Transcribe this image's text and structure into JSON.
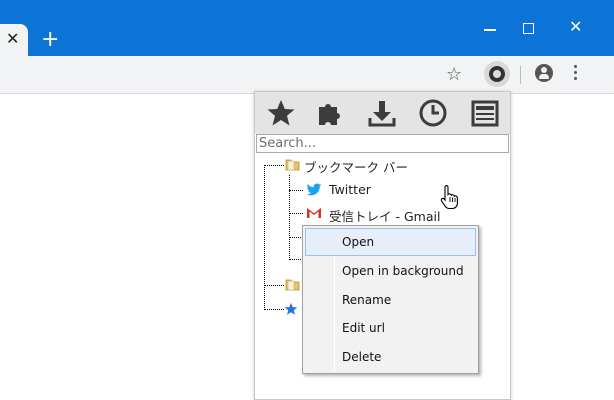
{
  "browser": {
    "tab_close_glyph": "✕",
    "new_tab_glyph": "+",
    "close_glyph": "✕",
    "bookmark_star_glyph": "☆",
    "accent_color": "#0b74d6"
  },
  "popup": {
    "toolbar_icons": [
      "star-icon",
      "puzzle-icon",
      "download-icon",
      "clock-icon",
      "newspaper-icon"
    ],
    "search": {
      "placeholder": "Search...",
      "value": ""
    },
    "tree": {
      "root_folder": "ブックマーク バー",
      "items": [
        {
          "icon": "twitter-icon",
          "label": "Twitter"
        },
        {
          "icon": "gmail-icon",
          "label": "受信トレイ - Gmail"
        }
      ]
    }
  },
  "context_menu": {
    "items": [
      {
        "label": "Open",
        "highlighted": true
      },
      {
        "label": "Open in background"
      },
      {
        "label": "Rename"
      },
      {
        "label": "Edit url"
      },
      {
        "label": "Delete"
      }
    ]
  }
}
